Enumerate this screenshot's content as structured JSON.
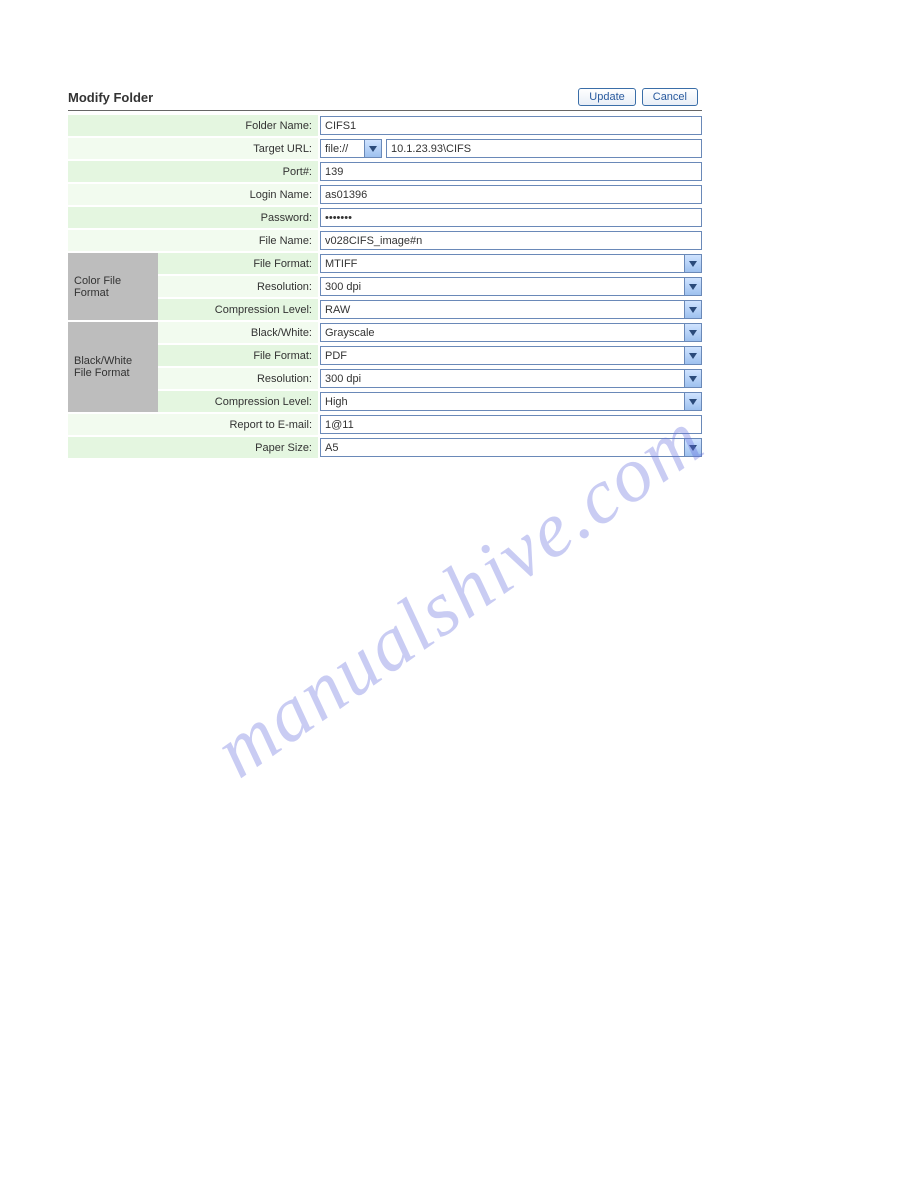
{
  "header": {
    "title": "Modify Folder",
    "update_btn": "Update",
    "cancel_btn": "Cancel"
  },
  "labels": {
    "folder_name": "Folder Name:",
    "target_url": "Target URL:",
    "port": "Port#:",
    "login_name": "Login Name:",
    "password": "Password:",
    "file_name": "File Name:",
    "color_group": "Color File Format",
    "bw_group": "Black/White File Format",
    "file_format": "File Format:",
    "resolution": "Resolution:",
    "compression": "Compression Level:",
    "black_white": "Black/White:",
    "report_email": "Report to E-mail:",
    "paper_size": "Paper Size:"
  },
  "values": {
    "folder_name": "CIFS1",
    "target_proto": "file://",
    "target_host": "10.1.23.93\\CIFS",
    "port": "139",
    "login_name": "as01396",
    "password": "•••••••",
    "file_name": "v028CIFS_image#n",
    "color_file_format": "MTIFF",
    "color_resolution": "300 dpi",
    "color_compression": "RAW",
    "bw_mode": "Grayscale",
    "bw_file_format": "PDF",
    "bw_resolution": "300 dpi",
    "bw_compression": "High",
    "report_email": "1@11",
    "paper_size": "A5"
  },
  "watermark": "manualshive.com"
}
